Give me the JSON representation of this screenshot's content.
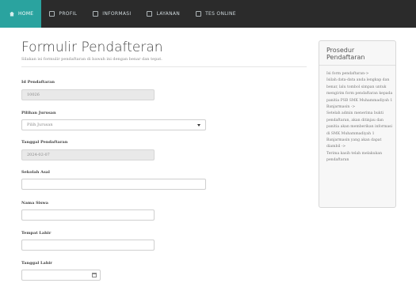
{
  "nav": {
    "items": [
      {
        "label": "HOME",
        "icon": "home-icon",
        "active": true
      },
      {
        "label": "PROFIL",
        "icon": "list-icon"
      },
      {
        "label": "INFORMASI",
        "icon": "info-icon"
      },
      {
        "label": "LAYANAN",
        "icon": "cog-icon"
      },
      {
        "label": "TES ONLINE",
        "icon": "edit-icon"
      }
    ],
    "accent": "#2aa39f",
    "background": "#2b2b2b"
  },
  "form": {
    "title": "Formulir Pendafteran",
    "subtitle": "Silakan isi formulir pendaftaran di bawah ini dengan benar dan tepat.",
    "fields": {
      "id": {
        "label": "Id Pendaftaran",
        "value": "10026"
      },
      "program": {
        "label": "Pilihan Jurusan",
        "value": "Pilih Jurusan"
      },
      "date": {
        "label": "Tanggal Pendaftaran",
        "value": "2024-02-07"
      },
      "school": {
        "label": "Sekolah Asal",
        "value": ""
      },
      "name": {
        "label": "Nama Siswa",
        "value": ""
      },
      "birthplace": {
        "label": "Tempat Lahir",
        "value": ""
      },
      "birthdate": {
        "label": "Tanggal Lahir",
        "value": ""
      }
    }
  },
  "sidebar": {
    "title": "Prosedur Pendaftaran",
    "body": "Isi form pendaftaran->\nIsilah data-data anda lengkap dan benar, lalu tombol simpan untuk mengirim form pendaftaran kepada panitia PSB SMK Muhammadiyah 1 Banjarmasin ->\nSetelah admin menerima bukti pendaftaran, akan ditinjau dan panitia akan memberikan informasi di SMK Muhammadiyah 1 Banjarmasin yang akan dapat diambil ->\nTerima kasih telah melakukan pendaftaran"
  }
}
